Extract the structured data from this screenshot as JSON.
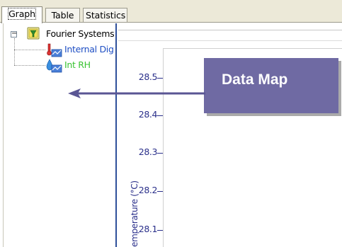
{
  "tabs": [
    {
      "label": "Graph",
      "active": true
    },
    {
      "label": "Table",
      "active": false
    },
    {
      "label": "Statistics",
      "active": false
    }
  ],
  "tree": {
    "expander": "−",
    "root": {
      "label": "Fourier Systems",
      "icon": "funnel-logger-icon"
    },
    "children": [
      {
        "label": "Internal Dig",
        "icon": "thermometer-sensor-icon",
        "color": "#1f4fc4"
      },
      {
        "label": "Int RH",
        "icon": "humidity-sensor-icon",
        "color": "#39c331"
      }
    ]
  },
  "graph": {
    "y_axis_title": "emperature (°C)",
    "y_ticks": [
      "28.5",
      "28.4",
      "28.3",
      "28.2",
      "28.1"
    ]
  },
  "callout": {
    "text": "Data Map",
    "background": "#6f6aa3"
  }
}
